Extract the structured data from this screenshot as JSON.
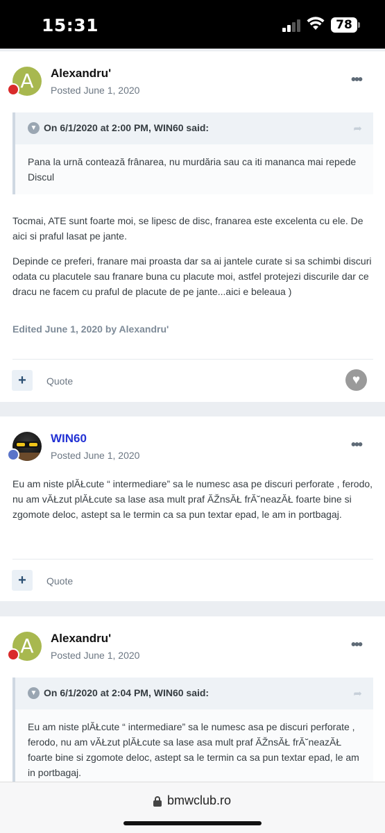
{
  "status_bar": {
    "time": "15:31",
    "battery": "78"
  },
  "posts": [
    {
      "avatar_letter": "A",
      "username": "Alexandru'",
      "posted": "Posted June 1, 2020",
      "more": "•••",
      "quote": {
        "header": "On 6/1/2020 at 2:00 PM, WIN60 said:",
        "body": "Pana la urnă contează frânarea, nu murdăria sau ca iti mananca mai repede Discul"
      },
      "paragraphs": [
        "Tocmai, ATE sunt foarte moi, se lipesc de disc, franarea este excelenta cu ele. De aici si praful lasat pe jante.",
        "Depinde ce preferi, franare mai proasta dar sa ai jantele curate si sa schimbi discuri odata cu placutele sau franare buna cu placute moi, astfel protejezi discurile dar ce dracu ne facem cu praful de placute de pe jante...aici e beleaua )"
      ],
      "edited": "Edited June 1, 2020 by Alexandru'",
      "plus": "+",
      "quote_label": "Quote"
    },
    {
      "username": "WIN60",
      "posted": "Posted June 1, 2020",
      "more": "•••",
      "paragraphs": [
        "Eu am niste plĂŁcute “ intermediare” sa le numesc asa pe discuri perforate , ferodo, nu am vĂŁzut plĂŁcute sa lase asa mult praf ĂŽnsĂŁ frĂ˘neazĂŁ foarte bine si zgomote deloc, astept sa le termin ca sa pun textar epad, le am in portbagaj."
      ],
      "plus": "+",
      "quote_label": "Quote"
    },
    {
      "avatar_letter": "A",
      "username": "Alexandru'",
      "posted": "Posted June 1, 2020",
      "more": "•••",
      "quote": {
        "header": "On 6/1/2020 at 2:04 PM, WIN60 said:",
        "body": "Eu am niste plĂŁcute “ intermediare” sa le numesc asa pe discuri perforate , ferodo, nu am vĂŁzut plĂŁcute sa lase asa mult praf ĂŽnsĂŁ frĂ˘neazĂŁ foarte bine si zgomote deloc, astept sa le termin ca sa pun textar epad, le am in portbagaj."
      }
    }
  ],
  "browser": {
    "url": "bmwclub.ro"
  }
}
